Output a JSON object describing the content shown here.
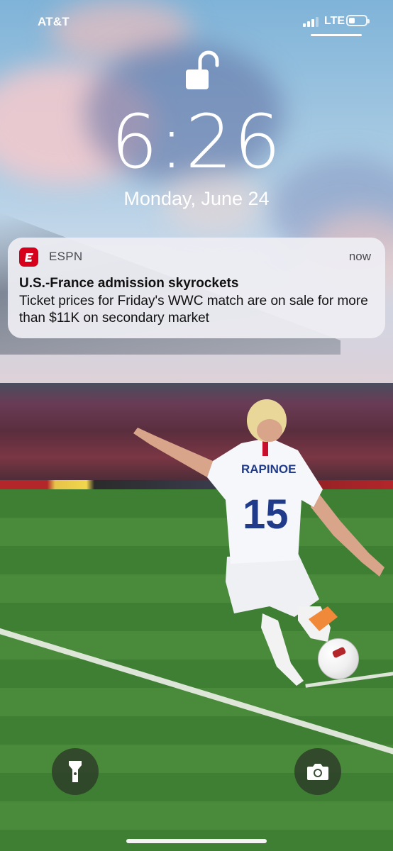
{
  "status_bar": {
    "carrier": "AT&T",
    "network": "LTE",
    "signal_bars": 3,
    "battery_level": 0.35
  },
  "lock": {
    "icon": "unlocked-padlock-icon",
    "time": "6:26",
    "date": "Monday, June 24"
  },
  "notification": {
    "app_icon": "espn-logo-icon",
    "app_name": "ESPN",
    "time": "now",
    "title": "U.S.-France admission skyrockets",
    "body": "Ticket prices for Friday's WWC match are on sale for more than $11K on secondary market"
  },
  "quick_actions": {
    "flashlight_icon": "flashlight-icon",
    "camera_icon": "camera-icon"
  },
  "wallpaper": {
    "jersey_name": "RAPINOE",
    "jersey_number": "15"
  },
  "colors": {
    "espn_red": "#d6001c",
    "notification_bg": "#eeeef3"
  }
}
